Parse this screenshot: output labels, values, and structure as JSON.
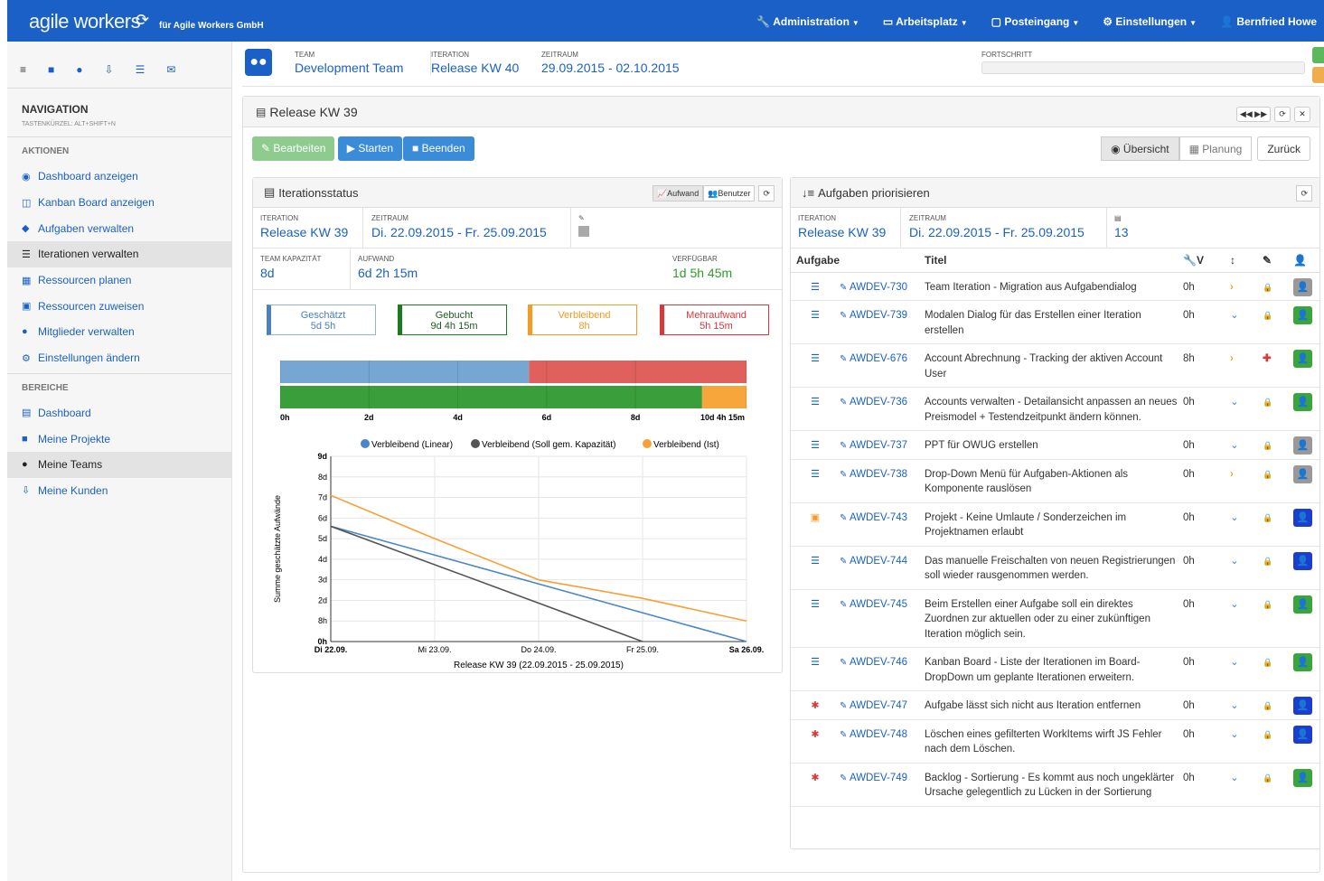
{
  "app": {
    "logo": "agile workers",
    "logo_icon": "⟳",
    "company": "für Agile Workers GmbH"
  },
  "topnav": [
    {
      "label": "Administration",
      "icon": "wrench-icon"
    },
    {
      "label": "Arbeitsplatz",
      "icon": "monitor-icon"
    },
    {
      "label": "Posteingang",
      "icon": "inbox-icon"
    },
    {
      "label": "Einstellungen",
      "icon": "gear-icon"
    },
    {
      "label": "Bernfried Howe",
      "icon": "user-icon"
    }
  ],
  "sidebar": {
    "nav_title": "NAVIGATION",
    "shortcut": "TASTENKÜRZEL: ALT+SHIFT+N",
    "section_actions": "AKTIONEN",
    "actions": [
      "Dashboard anzeigen",
      "Kanban Board anzeigen",
      "Aufgaben verwalten",
      "Iterationen verwalten",
      "Ressourcen planen",
      "Ressourcen zuweisen",
      "Mitglieder verwalten",
      "Einstellungen ändern"
    ],
    "section_areas": "BEREICHE",
    "areas": [
      "Dashboard",
      "Meine Projekte",
      "Meine Teams",
      "Meine Kunden"
    ]
  },
  "header": {
    "team_label": "TEAM",
    "team": "Development Team",
    "iter_label": "ITERATION",
    "iter": "Release KW 40",
    "zeit_label": "ZEITRAUM",
    "zeit": "29.09.2015 - 02.10.2015",
    "fort_label": "FORTSCHRITT"
  },
  "main": {
    "title": "Release KW 39",
    "btn_edit": "Bearbeiten",
    "btn_start": "Starten",
    "btn_end": "Beenden",
    "btn_overview": "Übersicht",
    "btn_plan": "Planung",
    "btn_back": "Zurück"
  },
  "left": {
    "title": "Iterationsstatus",
    "toggle_effort": "Aufwand",
    "toggle_users": "Benutzer",
    "iter_label": "ITERATION",
    "iter": "Release KW 39",
    "zeit_label": "ZEITRAUM",
    "zeit": "Di. 22.09.2015 - Fr. 25.09.2015",
    "cap_label": "TEAM KAPAZITÄT",
    "cap": "8d",
    "eff_label": "AUFWAND",
    "eff": "6d 2h 15m",
    "avail_label": "VERFÜGBAR",
    "avail": "1d 5h 45m",
    "boxes": [
      {
        "name": "Geschätzt",
        "val": "5d 5h",
        "color": "#4a7fc0"
      },
      {
        "name": "Gebucht",
        "val": "9d 4h 15m",
        "color": "#1e7a1e"
      },
      {
        "name": "Verbleibend",
        "val": "8h",
        "color": "#f39c25"
      },
      {
        "name": "Mehraufwand",
        "val": "5h 15m",
        "color": "#d9383a"
      }
    ],
    "bar_ticks": [
      "0h",
      "2d",
      "4d",
      "6d",
      "8d",
      "10d 4h 15m"
    ],
    "chart_data": {
      "type": "line",
      "x": [
        "Di 22.09.",
        "Mi 23.09.",
        "Do 24.09.",
        "Fr 25.09.",
        "Sa 26.09."
      ],
      "xlabel": "Release KW 39 (22.09.2015 - 25.09.2015)",
      "ylabel": "Summe geschätzte Aufwände",
      "yticks": [
        "0h",
        "8h",
        "2d",
        "3d",
        "4d",
        "5d",
        "6d",
        "7d",
        "8d",
        "9d"
      ],
      "ylim": [
        0,
        9
      ],
      "series": [
        {
          "name": "Verbleibend (Linear)",
          "color": "#4a86c8",
          "points": [
            [
              0,
              5.6
            ],
            [
              4,
              0
            ]
          ]
        },
        {
          "name": "Verbleibend (Soll gem. Kapazität)",
          "color": "#555555",
          "points": [
            [
              0,
              5.6
            ],
            [
              3,
              0
            ]
          ]
        },
        {
          "name": "Verbleibend (Ist)",
          "color": "#f7a035",
          "points": [
            [
              0,
              7.1
            ],
            [
              1,
              5.0
            ],
            [
              2,
              3.0
            ],
            [
              3,
              2.1
            ],
            [
              4,
              1.0
            ]
          ]
        }
      ]
    },
    "burn": {
      "est": 5.6,
      "rest": 10.5,
      "booked": 9.5,
      "remaining": 1.0,
      "max": 10.5
    }
  },
  "right": {
    "title": "Aufgaben priorisieren",
    "iter_label": "ITERATION",
    "iter": "Release KW 39",
    "zeit_label": "ZEITRAUM",
    "zeit": "Di. 22.09.2015 - Fr. 25.09.2015",
    "count": "13",
    "col_task": "Aufgabe",
    "col_title": "Titel",
    "col_v": "V",
    "rows": [
      {
        "type": "story",
        "key": "AWDEV-730",
        "title": "Team Iteration - Migration aus Aufgabendialog",
        "h": "0h",
        "arrow": "right",
        "lock": "lock",
        "sq": "#999"
      },
      {
        "type": "story",
        "key": "AWDEV-739",
        "title": "Modalen Dialog für das Erstellen einer Iteration erstellen",
        "h": "0h",
        "arrow": "down",
        "lock": "lock",
        "sq": "#3aa53a"
      },
      {
        "type": "story",
        "key": "AWDEV-676",
        "title": "Account Abrechnung - Tracking der aktiven Account User",
        "h": "8h",
        "arrow": "right",
        "lock": "plus",
        "sq": "#3aa53a"
      },
      {
        "type": "story",
        "key": "AWDEV-736",
        "title": "Accounts verwalten - Detailansicht anpassen an neues Preismodel + Testendzeitpunkt ändern können.",
        "h": "0h",
        "arrow": "down",
        "lock": "lock",
        "sq": "#3aa53a"
      },
      {
        "type": "story",
        "key": "AWDEV-737",
        "title": "PPT für OWUG erstellen",
        "h": "0h",
        "arrow": "down",
        "lock": "lock",
        "sq": "#999"
      },
      {
        "type": "story",
        "key": "AWDEV-738",
        "title": "Drop-Down Menü für Aufgaben-Aktionen als Komponente rauslösen",
        "h": "0h",
        "arrow": "right",
        "lock": "lock",
        "sq": "#999"
      },
      {
        "type": "gift",
        "key": "AWDEV-743",
        "title": "Projekt - Keine Umlaute / Sonderzeichen im Projektnamen erlaubt",
        "h": "0h",
        "arrow": "down",
        "lock": "lock",
        "sq": "#1a3fd0"
      },
      {
        "type": "story",
        "key": "AWDEV-744",
        "title": "Das manuelle Freischalten von neuen Registrierungen soll wieder rausgenommen werden.",
        "h": "0h",
        "arrow": "down",
        "lock": "lock",
        "sq": "#1a3fd0"
      },
      {
        "type": "story",
        "key": "AWDEV-745",
        "title": "Beim Erstellen einer Aufgabe soll ein direktes Zuordnen zur aktuellen oder zu einer zukünftigen Iteration möglich sein.",
        "h": "0h",
        "arrow": "down",
        "lock": "lock",
        "sq": "#3aa53a"
      },
      {
        "type": "story",
        "key": "AWDEV-746",
        "title": "Kanban Board - Liste der Iterationen im Board-DropDown um geplante Iterationen erweitern.",
        "h": "0h",
        "arrow": "down",
        "lock": "lock",
        "sq": "#3aa53a"
      },
      {
        "type": "bug",
        "key": "AWDEV-747",
        "title": "Aufgabe lässt sich nicht aus Iteration entfernen",
        "h": "0h",
        "arrow": "down",
        "lock": "lock",
        "sq": "#1a3fd0"
      },
      {
        "type": "bug",
        "key": "AWDEV-748",
        "title": "Löschen eines gefilterten WorkItems wirft JS Fehler nach dem Löschen.",
        "h": "0h",
        "arrow": "down",
        "lock": "lock",
        "sq": "#1a3fd0"
      },
      {
        "type": "bug",
        "key": "AWDEV-749",
        "title": "Backlog - Sortierung - Es kommt aus noch ungeklärter Ursache gelegentlich zu Lücken in der Sortierung",
        "h": "0h",
        "arrow": "down",
        "lock": "lock",
        "sq": "#3aa53a"
      }
    ]
  }
}
